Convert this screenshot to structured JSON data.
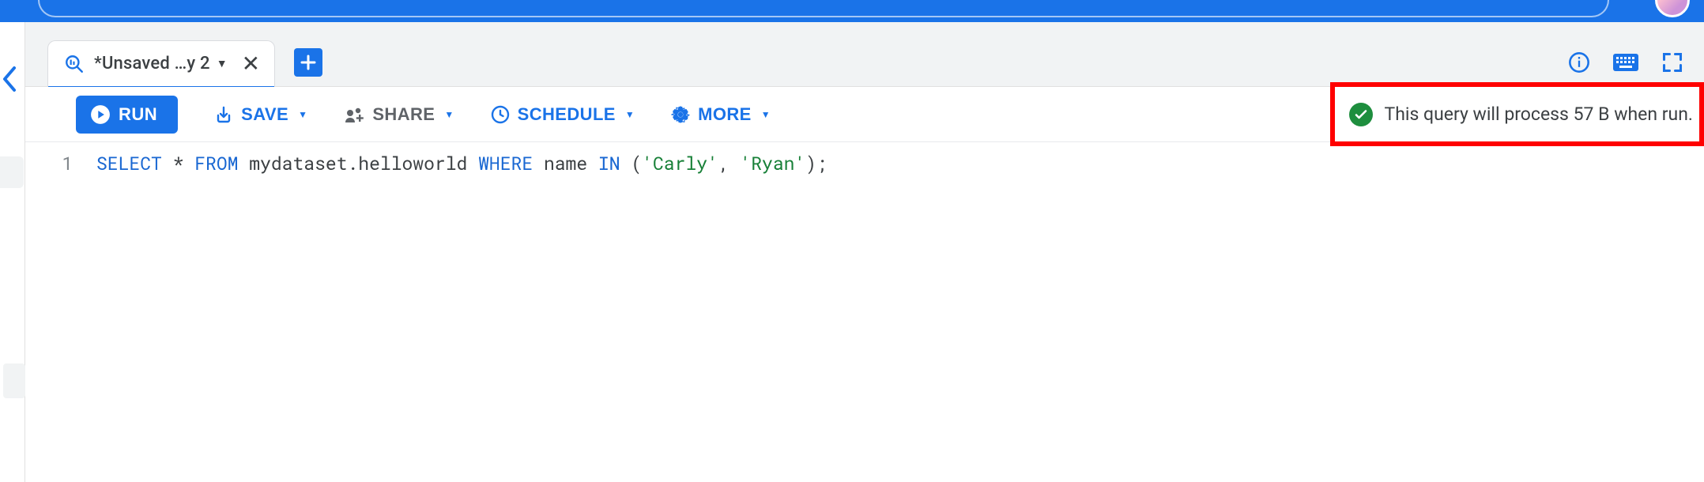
{
  "tabs": {
    "active": {
      "label": "*Unsaved …y 2"
    }
  },
  "toolbar": {
    "run_label": "RUN",
    "save_label": "SAVE",
    "share_label": "SHARE",
    "schedule_label": "SCHEDULE",
    "more_label": "MORE"
  },
  "status": {
    "message": "This query will process 57 B when run."
  },
  "editor": {
    "line_number": "1",
    "sql": {
      "kw_select": "SELECT",
      "star": " * ",
      "kw_from": "FROM",
      "table": " mydataset.helloworld ",
      "kw_where": "WHERE",
      "col": " name ",
      "kw_in": "IN",
      "paren_open": " (",
      "str1": "'Carly'",
      "comma": ", ",
      "str2": "'Ryan'",
      "paren_close": ");"
    }
  }
}
